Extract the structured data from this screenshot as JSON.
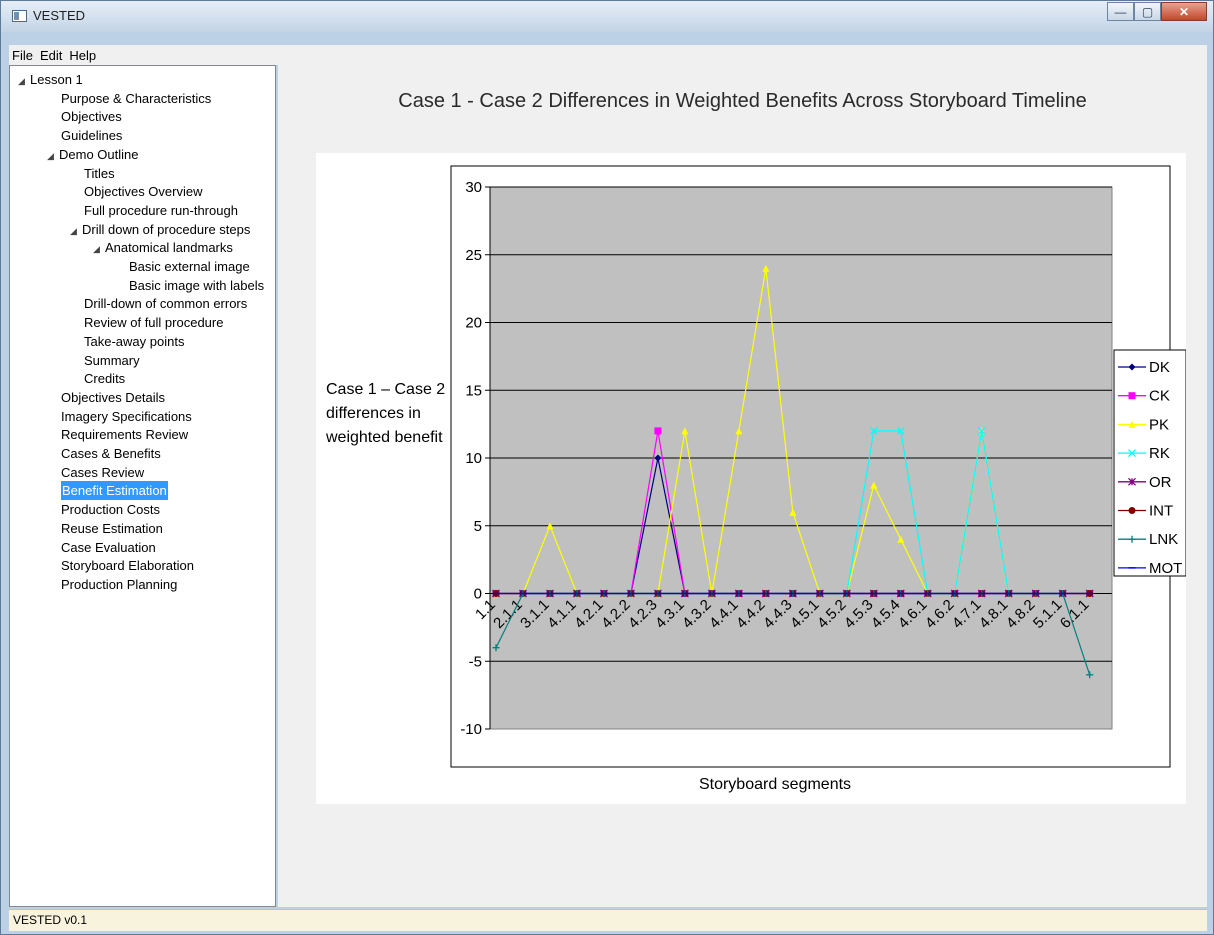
{
  "window": {
    "title": "VESTED"
  },
  "menu": [
    "File",
    "Edit",
    "Help"
  ],
  "sidebar": {
    "items": [
      {
        "label": "Lesson 1",
        "indent": 0,
        "expanded": true
      },
      {
        "label": "Purpose & Characteristics",
        "indent": 1
      },
      {
        "label": "Objectives",
        "indent": 1
      },
      {
        "label": "Guidelines",
        "indent": 1
      },
      {
        "label": "Demo Outline",
        "indent": 1,
        "expanded": true
      },
      {
        "label": "Titles",
        "indent": 2
      },
      {
        "label": "Objectives Overview",
        "indent": 2
      },
      {
        "label": "Full procedure run-through",
        "indent": 2
      },
      {
        "label": "Drill down of procedure steps",
        "indent": 2,
        "expanded": true
      },
      {
        "label": "Anatomical landmarks",
        "indent": 3,
        "expanded": true
      },
      {
        "label": "Basic external image",
        "indent": 4
      },
      {
        "label": "Basic image with labels",
        "indent": 4
      },
      {
        "label": "Drill-down of common errors",
        "indent": 2
      },
      {
        "label": "Review of full procedure",
        "indent": 2
      },
      {
        "label": "Take-away points",
        "indent": 2
      },
      {
        "label": "Summary",
        "indent": 2
      },
      {
        "label": "Credits",
        "indent": 2
      },
      {
        "label": "Objectives Details",
        "indent": 1
      },
      {
        "label": "Imagery Specifications",
        "indent": 1
      },
      {
        "label": "Requirements Review",
        "indent": 1
      },
      {
        "label": "Cases & Benefits",
        "indent": 1
      },
      {
        "label": "Cases Review",
        "indent": 1
      },
      {
        "label": "Benefit Estimation",
        "indent": 1,
        "selected": true
      },
      {
        "label": "Production Costs",
        "indent": 1
      },
      {
        "label": "Reuse Estimation",
        "indent": 1
      },
      {
        "label": "Case Evaluation",
        "indent": 1
      },
      {
        "label": "Storyboard Elaboration",
        "indent": 1
      },
      {
        "label": "Production Planning",
        "indent": 1
      }
    ]
  },
  "page": {
    "title": "Case 1 - Case 2 Differences in Weighted Benefits Across Storyboard Timeline"
  },
  "chart_data": {
    "type": "line",
    "title": "",
    "xlabel": "Storyboard segments",
    "ylabel": "Case 1 – Case 2 differences in weighted benefit",
    "ylim": [
      -10,
      30
    ],
    "yticks": [
      -10,
      -5,
      0,
      5,
      10,
      15,
      20,
      25,
      30
    ],
    "grid": true,
    "legend_position": "right",
    "plot_background": "#c0c0c0",
    "categories": [
      "1.1",
      "2.1.1",
      "3.1.1",
      "4.1.1",
      "4.2.1",
      "4.2.2",
      "4.2.3",
      "4.3.1",
      "4.3.2",
      "4.4.1",
      "4.4.2",
      "4.4.3",
      "4.5.1",
      "4.5.2",
      "4.5.3",
      "4.5.4",
      "4.6.1",
      "4.6.2",
      "4.7.1",
      "4.8.1",
      "4.8.2",
      "5.1.1",
      "6.1.1"
    ],
    "series": [
      {
        "name": "DK",
        "color": "#000080",
        "marker": "diamond",
        "values": [
          0,
          0,
          0,
          0,
          0,
          0,
          10,
          0,
          0,
          0,
          0,
          0,
          0,
          0,
          0,
          0,
          0,
          0,
          0,
          0,
          0,
          0,
          0
        ]
      },
      {
        "name": "CK",
        "color": "#ff00ff",
        "marker": "square",
        "values": [
          0,
          0,
          0,
          0,
          0,
          0,
          12,
          0,
          0,
          0,
          0,
          0,
          0,
          0,
          0,
          0,
          0,
          0,
          0,
          0,
          0,
          0,
          0
        ]
      },
      {
        "name": "PK",
        "color": "#ffff00",
        "marker": "triangle",
        "values": [
          0,
          0,
          5,
          0,
          0,
          0,
          0,
          12,
          0,
          12,
          24,
          6,
          0,
          0,
          8,
          4,
          0,
          0,
          12,
          0,
          0,
          0,
          0
        ]
      },
      {
        "name": "RK",
        "color": "#00ffff",
        "marker": "x",
        "values": [
          0,
          0,
          0,
          0,
          0,
          0,
          0,
          0,
          0,
          0,
          0,
          0,
          0,
          0,
          12,
          12,
          0,
          0,
          12,
          0,
          0,
          0,
          0
        ]
      },
      {
        "name": "OR",
        "color": "#800080",
        "marker": "star",
        "values": [
          0,
          0,
          0,
          0,
          0,
          0,
          0,
          0,
          0,
          0,
          0,
          0,
          0,
          0,
          0,
          0,
          0,
          0,
          0,
          0,
          0,
          0,
          0
        ]
      },
      {
        "name": "INT",
        "color": "#800000",
        "marker": "circle",
        "values": [
          0,
          0,
          0,
          0,
          0,
          0,
          0,
          0,
          0,
          0,
          0,
          0,
          0,
          0,
          0,
          0,
          0,
          0,
          0,
          0,
          0,
          0,
          0
        ]
      },
      {
        "name": "LNK",
        "color": "#008080",
        "marker": "plus",
        "values": [
          -4,
          0,
          0,
          0,
          0,
          0,
          0,
          0,
          0,
          0,
          0,
          0,
          0,
          0,
          0,
          0,
          0,
          0,
          0,
          0,
          0,
          0,
          -6
        ]
      },
      {
        "name": "MOT",
        "color": "#0000ff",
        "marker": "dash",
        "values": [
          0,
          0,
          0,
          0,
          0,
          0,
          0,
          0,
          0,
          0,
          0,
          0,
          0,
          0,
          0,
          0,
          0,
          0,
          0,
          0,
          0,
          0,
          0
        ]
      }
    ]
  },
  "status": {
    "text": "VESTED v0.1"
  }
}
